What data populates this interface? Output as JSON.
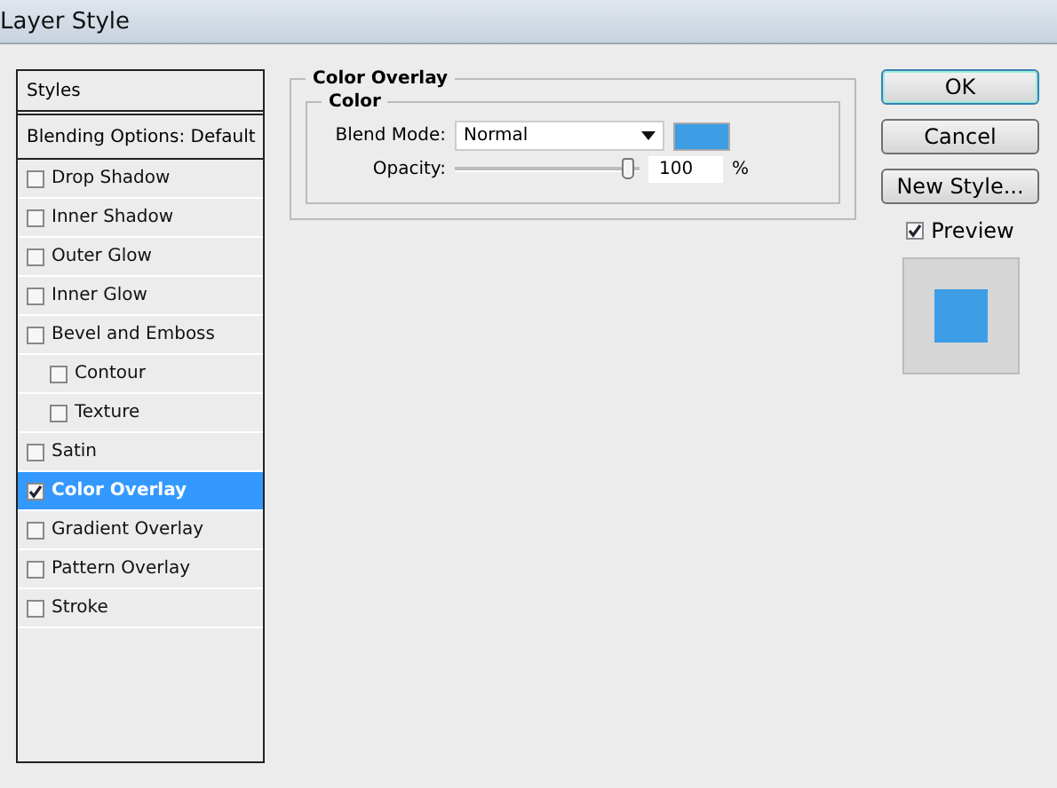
{
  "window": {
    "title": "Layer Style"
  },
  "styles_panel": {
    "header": "Styles",
    "blending": "Blending Options: Default",
    "items": [
      {
        "label": "Drop Shadow",
        "checked": false,
        "selected": false
      },
      {
        "label": "Inner Shadow",
        "checked": false,
        "selected": false
      },
      {
        "label": "Outer Glow",
        "checked": false,
        "selected": false
      },
      {
        "label": "Inner Glow",
        "checked": false,
        "selected": false
      },
      {
        "label": "Bevel and Emboss",
        "checked": false,
        "selected": false,
        "children": [
          {
            "label": "Contour",
            "checked": false,
            "selected": false
          },
          {
            "label": "Texture",
            "checked": false,
            "selected": false
          }
        ]
      },
      {
        "label": "Satin",
        "checked": false,
        "selected": false
      },
      {
        "label": "Color Overlay",
        "checked": true,
        "selected": true
      },
      {
        "label": "Gradient Overlay",
        "checked": false,
        "selected": false
      },
      {
        "label": "Pattern Overlay",
        "checked": false,
        "selected": false
      },
      {
        "label": "Stroke",
        "checked": false,
        "selected": false
      }
    ]
  },
  "color_overlay": {
    "title": "Color Overlay",
    "group": "Color",
    "blend_mode_label": "Blend Mode:",
    "blend_mode": "Normal",
    "swatch": {
      "color": "#3d9ee5"
    },
    "opacity_label": "Opacity:",
    "opacity": {
      "level": 0.97
    },
    "opacity_value": "100",
    "opacity_unit": "%"
  },
  "buttons": [
    {
      "label": "OK",
      "default": true
    },
    {
      "label": "Cancel",
      "default": false
    },
    {
      "label": "New Style...",
      "default": false
    }
  ],
  "preview": {
    "label": "Preview",
    "checked": true,
    "color": "#3d9ee5"
  }
}
